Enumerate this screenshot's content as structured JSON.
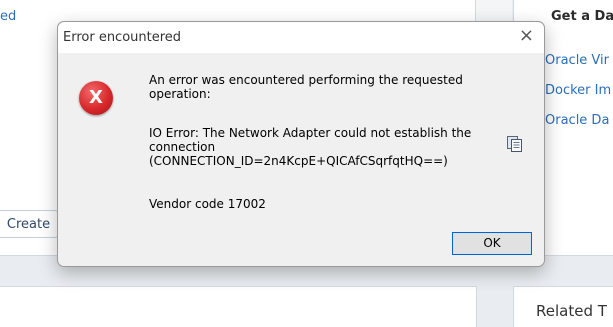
{
  "background": {
    "top_link": "ed",
    "create_button": "Create",
    "get_title": "Get a Da",
    "right_links": [
      "Oracle Vir",
      "Docker Im",
      "Oracle Da"
    ],
    "related_title": "Related T"
  },
  "dialog": {
    "title": "Error encountered",
    "close_symbol": "×",
    "icon_letter": "X",
    "message_line1": "An error was encountered performing the requested operation:",
    "message_line2": "IO Error: The Network Adapter could not establish the connection",
    "message_line3": "(CONNECTION_ID=2n4KcpE+QICAfCSqrfqtHQ==)",
    "message_line4": "Vendor code 17002",
    "ok_label": "OK"
  },
  "colors": {
    "link": "#2a6ebb",
    "error_red": "#d8282b",
    "ok_border": "#0a64c8"
  }
}
